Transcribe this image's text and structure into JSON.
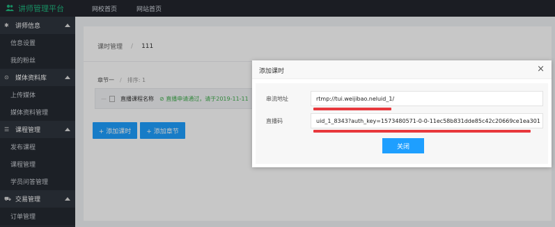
{
  "top": {
    "brand": "讲师管理平台",
    "nav": [
      "网校首页",
      "网站首页"
    ]
  },
  "sidebar": {
    "groups": [
      {
        "label": "讲师信息",
        "icon": "gear-icon",
        "items": [
          "信息设置",
          "我的粉丝"
        ]
      },
      {
        "label": "媒体资料库",
        "icon": "play-circle-icon",
        "items": [
          "上传媒体",
          "媒体资料管理"
        ]
      },
      {
        "label": "课程管理",
        "icon": "list-icon",
        "items": [
          "发布课程",
          "课程管理",
          "学员问答管理"
        ]
      },
      {
        "label": "交易管理",
        "icon": "cart-icon",
        "items": [
          "订单管理"
        ]
      }
    ]
  },
  "main": {
    "breadcrumb": {
      "root": "课时管理",
      "sep": "/",
      "current": "111"
    },
    "chapter": {
      "name": "章节一",
      "sep": "/",
      "sort": "排序: 1"
    },
    "lesson": {
      "dash": "—",
      "name": "直播课程名称",
      "status": "直播申请通过，请于2019-11-11"
    },
    "buttons": {
      "add_lesson": "+ 添加课时",
      "add_chapter": "+ 添加章节"
    }
  },
  "modal": {
    "title": "添加课时",
    "close": "×",
    "fields": [
      {
        "label": "串流地址",
        "value": "rtmp://tui.weijibao.neluid_1/"
      },
      {
        "label": "直播码",
        "value": "uid_1_8343?auth_key=1573480571-0-0-11ec58b831dde85c42c20669ce1ea301"
      }
    ],
    "close_button": "关闭"
  },
  "colors": {
    "brand": "#1fb57e",
    "primary": "#1e9fff",
    "highlight": "#e8383d",
    "success": "#3fae4d"
  }
}
